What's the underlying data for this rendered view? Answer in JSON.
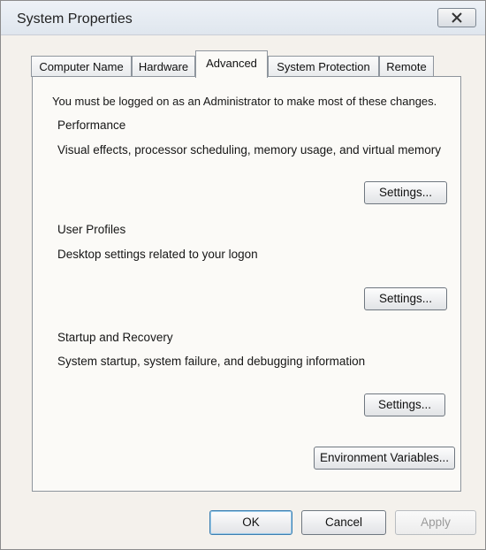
{
  "window": {
    "title": "System Properties",
    "close_icon": "close-icon"
  },
  "tabs": [
    {
      "label": "Computer Name",
      "active": false
    },
    {
      "label": "Hardware",
      "active": false
    },
    {
      "label": "Advanced",
      "active": true
    },
    {
      "label": "System Protection",
      "active": false
    },
    {
      "label": "Remote",
      "active": false
    }
  ],
  "panel": {
    "admin_note": "You must be logged on as an Administrator to make most of these changes.",
    "performance": {
      "heading": "Performance",
      "description": "Visual effects, processor scheduling, memory usage, and virtual memory",
      "button": "Settings..."
    },
    "user_profiles": {
      "heading": "User Profiles",
      "description": "Desktop settings related to your logon",
      "button": "Settings..."
    },
    "startup_recovery": {
      "heading": "Startup and Recovery",
      "description": "System startup, system failure, and debugging information",
      "button": "Settings..."
    },
    "env_button": "Environment Variables..."
  },
  "footer": {
    "ok": "OK",
    "cancel": "Cancel",
    "apply": "Apply"
  }
}
